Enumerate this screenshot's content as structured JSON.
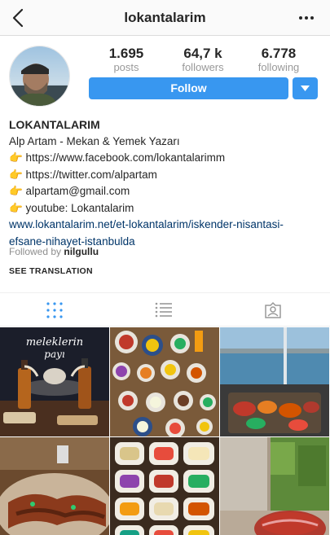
{
  "topbar": {
    "title": "lokantalarim",
    "back_icon": "chevron-left-icon",
    "more_icon": "more-horizontal-icon"
  },
  "stats": [
    {
      "value": "1.695",
      "label": "posts"
    },
    {
      "value": "64,7 k",
      "label": "followers"
    },
    {
      "value": "6.778",
      "label": "following"
    }
  ],
  "actions": {
    "follow_label": "Follow",
    "dropdown_icon": "caret-down-icon"
  },
  "bio": {
    "name": "LOKANTALARIM",
    "subtitle": "Alp Artam - Mekan & Yemek Yazarı",
    "lines": [
      "👉 https://www.facebook.com/lokantalarimm",
      "👉 https://twitter.com/alpartam",
      "👉 alpartam@gmail.com",
      "👉 youtube: Lokantalarim"
    ],
    "website_line1": "www.lokantalarim.net/et-lokantalarim/iskender-nisantasi-",
    "website_line2": "efsane-nihayet-istanbulda"
  },
  "followed_by": {
    "prefix": "Followed by",
    "user": "nilgullu"
  },
  "translation_label": "SEE TRANSLATION",
  "tabs": [
    {
      "icon": "grid-icon",
      "active": true
    },
    {
      "icon": "list-icon",
      "active": false
    },
    {
      "icon": "tagged-icon",
      "active": false
    }
  ],
  "posts": {
    "tile1_text_line1": "meleklerin",
    "tile1_text_line2": "payı"
  },
  "colors": {
    "accent": "#3897f0",
    "link": "#003569",
    "muted": "#999999"
  }
}
